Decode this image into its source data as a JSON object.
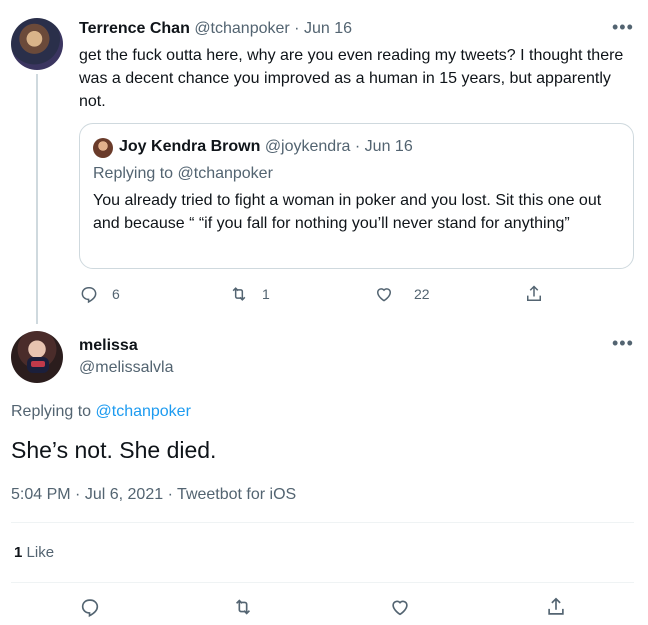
{
  "quoted_parent": {
    "author_name": "Terrence Chan",
    "author_handle": "@tchanpoker",
    "separator": "·",
    "date": "Jun 16",
    "more_icon": "more-icon",
    "text": "get the fuck outta here, why are you even reading my tweets? I thought there was a decent chance you improved as a human in 15 years, but apparently not.",
    "quote": {
      "author_name": "Joy Kendra Brown",
      "author_handle": "@joykendra",
      "separator": "·",
      "date": "Jun 16",
      "replying_prefix": "Replying to",
      "replying_handle": "@tchanpoker",
      "text": "You already tried to fight a woman in poker and you lost. Sit this one out and because “ “if you fall for nothing you’ll never stand for anything”"
    },
    "actions": {
      "reply_count": "6",
      "retweet_count": "1",
      "like_count": "22"
    }
  },
  "main_tweet": {
    "author_name": "melissa",
    "author_handle": "@melissalvla",
    "replying_prefix": "Replying to",
    "replying_handle": "@tchanpoker",
    "text": "She’s not. She died.",
    "time": "5:04 PM",
    "separator_1": "·",
    "date": "Jul 6, 2021",
    "separator_2": "·",
    "source": "Tweetbot for iOS",
    "likes_count": "1",
    "likes_label": "Like"
  },
  "colors": {
    "accent": "#1d9bf0",
    "muted": "#536471",
    "text": "#0f1419",
    "border": "#cfd9de"
  },
  "icons": [
    "reply-icon",
    "retweet-icon",
    "like-icon",
    "share-icon",
    "more-icon"
  ]
}
